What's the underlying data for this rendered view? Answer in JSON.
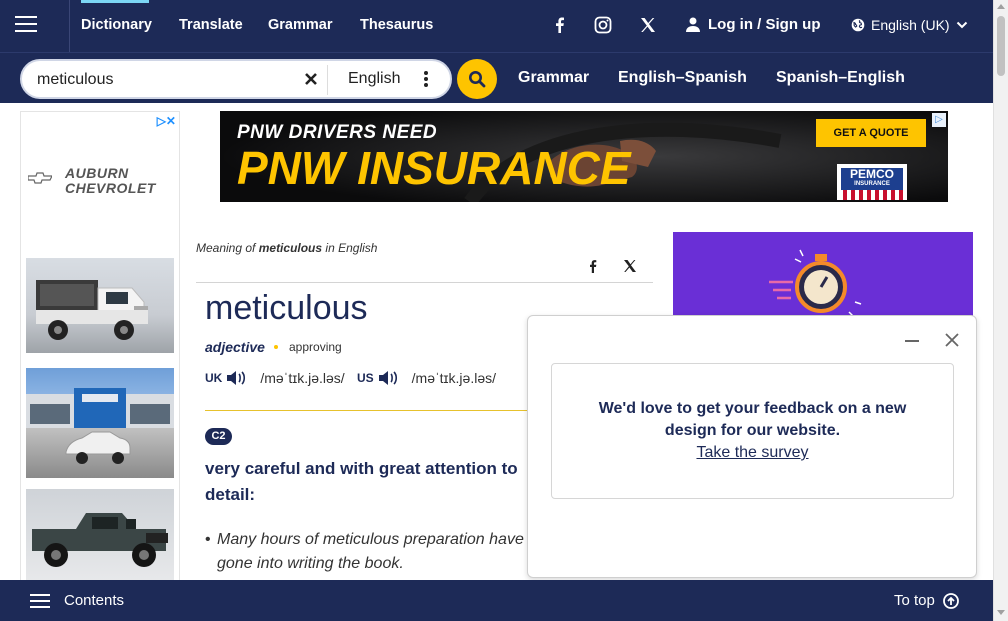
{
  "nav": {
    "links": [
      "Dictionary",
      "Translate",
      "Grammar",
      "Thesaurus"
    ],
    "login": "Log in / Sign up",
    "language": "English (UK)"
  },
  "search": {
    "value": "meticulous",
    "language": "English",
    "sublinks": [
      "Grammar",
      "English–Spanish",
      "Spanish–English"
    ]
  },
  "ads": {
    "left_dealer": "AUBURN\nCHEVROLET",
    "banner_line1": "PNW DRIVERS NEED",
    "banner_line2": "PNW INSURANCE",
    "banner_cta": "GET A QUOTE",
    "banner_brand": "PEMCO",
    "banner_brand_sub": "INSURANCE"
  },
  "entry": {
    "meaning_prefix": "Meaning of ",
    "meaning_word": "meticulous",
    "meaning_suffix": " in English",
    "headword": "meticulous",
    "pos": "adjective",
    "register": "approving",
    "uk_label": "UK",
    "uk_ipa": "/məˈtɪk.jə.ləs/",
    "us_label": "US",
    "us_ipa": "/məˈtɪk.jə.ləs/",
    "level": "C2",
    "definition": "very careful and with great attention to detail:",
    "example": "Many hours of meticulous preparation have gone into writing the book."
  },
  "feedback": {
    "message": "We'd love to get your feedback on a new design for our website.",
    "link": "Take the survey"
  },
  "bottom": {
    "contents": "Contents",
    "totop": "To top"
  },
  "colors": {
    "navy": "#1d2a57",
    "yellow": "#fec400",
    "purple": "#6a2fd6"
  }
}
